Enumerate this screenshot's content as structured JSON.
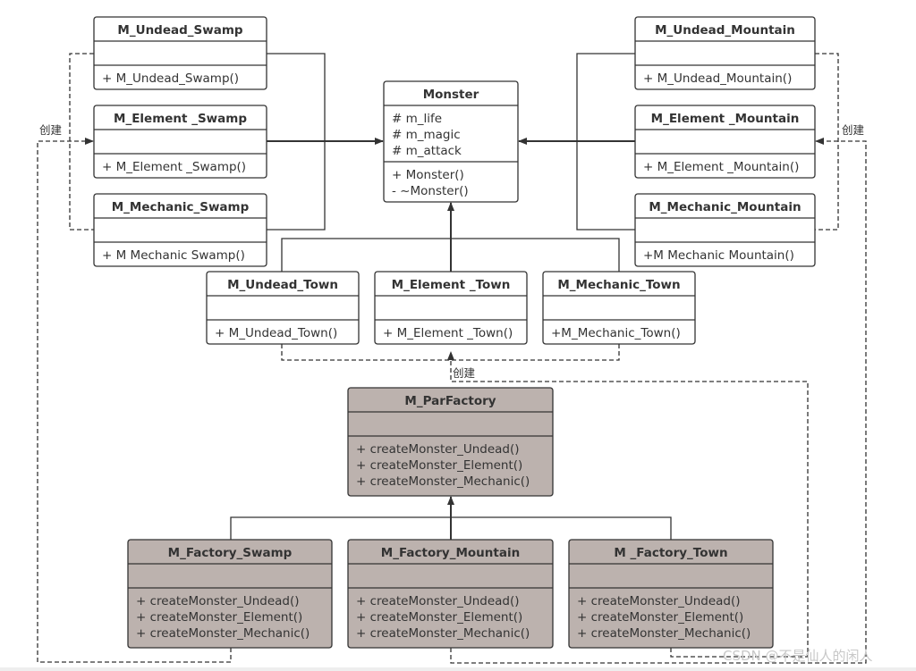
{
  "colors": {
    "line": "#333333",
    "product_fill": "#ffffff",
    "factory_fill": "#bcb2ae"
  },
  "classes": [
    {
      "id": "m-undead-swamp",
      "name": "M_Undead_Swamp",
      "attributes": [],
      "methods": [
        "+ M_Undead_Swamp()"
      ],
      "kind": "product"
    },
    {
      "id": "m-element-swamp",
      "name": "M_Element _Swamp",
      "attributes": [],
      "methods": [
        "+ M_Element _Swamp()"
      ],
      "kind": "product"
    },
    {
      "id": "m-mechanic-swamp",
      "name": "M_Mechanic_Swamp",
      "attributes": [],
      "methods": [
        "+ M  Mechanic  Swamp()"
      ],
      "kind": "product"
    },
    {
      "id": "m-undead-mountain",
      "name": "M_Undead_Mountain",
      "attributes": [],
      "methods": [
        "+ M_Undead_Mountain()"
      ],
      "kind": "product"
    },
    {
      "id": "m-element-mountain",
      "name": "M_Element _Mountain",
      "attributes": [],
      "methods": [
        "+ M_Element _Mountain()"
      ],
      "kind": "product"
    },
    {
      "id": "m-mechanic-mountain",
      "name": "M_Mechanic_Mountain",
      "attributes": [],
      "methods": [
        "+M  Mechanic  Mountain()"
      ],
      "kind": "product"
    },
    {
      "id": "monster",
      "name": "Monster",
      "attributes": [
        "# m_life",
        "# m_magic",
        "# m_attack"
      ],
      "methods": [
        "+ Monster()",
        "-  ~Monster()"
      ],
      "kind": "product"
    },
    {
      "id": "m-undead-town",
      "name": "M_Undead_Town",
      "attributes": [],
      "methods": [
        "+ M_Undead_Town()"
      ],
      "kind": "product"
    },
    {
      "id": "m-element-town",
      "name": "M_Element _Town",
      "attributes": [],
      "methods": [
        "+ M_Element _Town()"
      ],
      "kind": "product"
    },
    {
      "id": "m-mechanic-town",
      "name": "M_Mechanic_Town",
      "attributes": [],
      "methods": [
        "+M_Mechanic_Town()"
      ],
      "kind": "product"
    },
    {
      "id": "m-parfactory",
      "name": "M_ParFactory",
      "attributes": [],
      "methods": [
        "+ createMonster_Undead()",
        "+ createMonster_Element()",
        "+ createMonster_Mechanic()"
      ],
      "kind": "factory"
    },
    {
      "id": "m-factory-swamp",
      "name": "M_Factory_Swamp",
      "attributes": [],
      "methods": [
        "+ createMonster_Undead()",
        "+ createMonster_Element()",
        "+ createMonster_Mechanic()"
      ],
      "kind": "factory"
    },
    {
      "id": "m-factory-mountain",
      "name": "M_Factory_Mountain",
      "attributes": [],
      "methods": [
        "+ createMonster_Undead()",
        "+ createMonster_Element()",
        "+ createMonster_Mechanic()"
      ],
      "kind": "factory"
    },
    {
      "id": "m-factory-town",
      "name": "M _Factory_Town",
      "attributes": [],
      "methods": [
        "+ createMonster_Undead()",
        "+ createMonster_Element()",
        "+ createMonster_Mechanic()"
      ],
      "kind": "factory"
    }
  ],
  "labels": {
    "create_left": "创建",
    "create_right": "创建",
    "create_town": "创建"
  },
  "watermark": "CSDN @不是仙人的闲人"
}
